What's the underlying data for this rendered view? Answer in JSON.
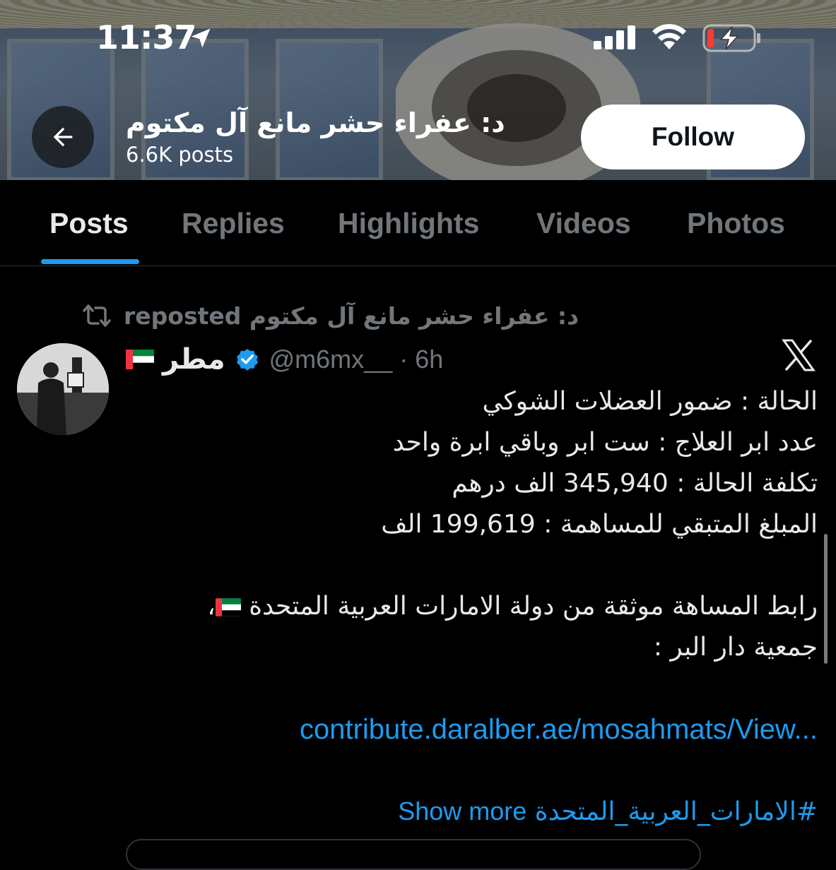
{
  "status_bar": {
    "time": "11:37",
    "icons": [
      "location-arrow-icon",
      "cellular-signal-icon",
      "wifi-icon",
      "battery-charging-icon"
    ],
    "battery_color": "#ff3b30"
  },
  "header": {
    "profile_name": "د: عفراء حشر مانع آل مكتوم",
    "post_count": "6.6K posts",
    "follow_label": "Follow"
  },
  "tabs": [
    {
      "label": "Posts",
      "active": true
    },
    {
      "label": "Replies",
      "active": false
    },
    {
      "label": "Highlights",
      "active": false
    },
    {
      "label": "Videos",
      "active": false
    },
    {
      "label": "Photos",
      "active": false
    }
  ],
  "post": {
    "repost_text": "د: عفراء حشر مانع آل مكتوم reposted",
    "author_name": "مطر",
    "author_handle": "@m6mx__ · 6h",
    "verified": true,
    "lines": {
      "l1": "الحالة : ضمور العضلات الشوكي",
      "l2": "عدد ابر العلاج : ست ابر وباقي ابرة واحد",
      "l3": "تكلفة الحالة : 345,940 الف درهم",
      "l4": "المبلغ المتبقي للمساهمة : 199,619 الف",
      "l5": "رابط المساهة موثقة من دولة الامارات العربية المتحدة",
      "l5_suffix": "،",
      "l6": "جمعية دار البر :"
    },
    "link": "contribute.daralber.ae/mosahmats/View...",
    "hashtag": "#الامارات_العربية_المتحدة",
    "show_more": "Show more"
  },
  "colors": {
    "accent": "#1d9bf0",
    "muted": "#71767b",
    "background": "#000000",
    "text": "#e7e9ea"
  }
}
